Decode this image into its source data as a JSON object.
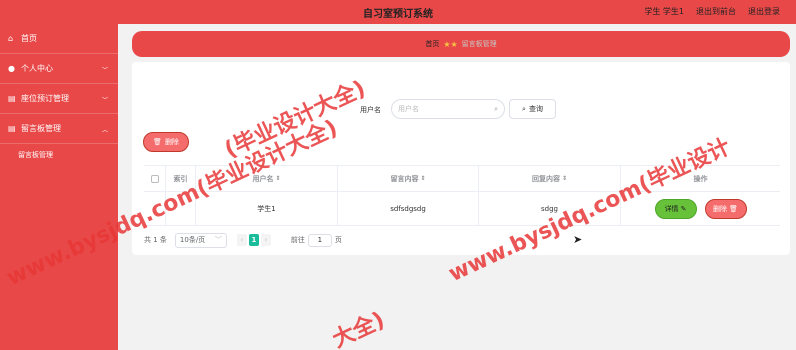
{
  "header": {
    "title": "自习室预订系统",
    "user_label": "学生 学生1",
    "back_label": "退出到前台",
    "logout_label": "退出登录"
  },
  "sidebar": {
    "items": [
      {
        "label": "首页",
        "icon": "home-icon"
      },
      {
        "label": "个人中心",
        "icon": "user-icon"
      },
      {
        "label": "座位预订管理",
        "icon": "list-icon"
      },
      {
        "label": "留言板管理",
        "icon": "list-icon"
      }
    ],
    "sub_items": [
      {
        "label": "留言板管理"
      }
    ]
  },
  "breadcrumb": {
    "home": "首页",
    "current": "留言板管理"
  },
  "search": {
    "label": "用户名",
    "placeholder": "用户名",
    "query_label": "查询"
  },
  "toolbar": {
    "delete_label": "删除"
  },
  "table": {
    "columns": [
      "索引",
      "用户名",
      "留言内容",
      "回复内容",
      "操作"
    ],
    "rows": [
      {
        "username": "学生1",
        "message": "sdfsdgsdg",
        "reply": "sdgg",
        "detail_label": "详情",
        "delete_label": "删除"
      }
    ]
  },
  "pagination": {
    "total": "共 1 条",
    "page_size": "10条/页",
    "current_page": "1",
    "goto_label": "前往",
    "goto_value": "1",
    "page_suffix": "页"
  },
  "watermarks": [
    "www.bysjdq.com(毕业设计大全)",
    "www.bysjdq.com(毕业设计",
    "(毕业设计大全)",
    "大全)"
  ],
  "colors": {
    "accent": "#e84848",
    "success": "#67c23a",
    "danger": "#f56c6c",
    "page_active": "#1abc9c"
  }
}
